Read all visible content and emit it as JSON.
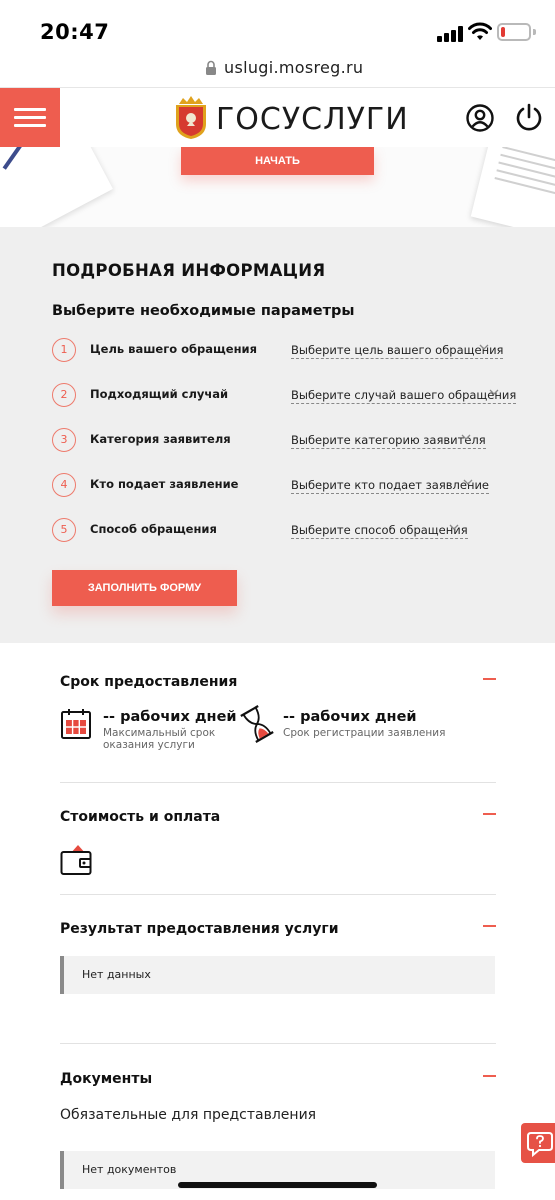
{
  "status_bar": {
    "time": "20:47"
  },
  "browser": {
    "url": "uslugi.mosreg.ru"
  },
  "header": {
    "logo_text": "ГОСУСЛУГИ"
  },
  "hero": {
    "start_button": "НАЧАТЬ"
  },
  "details": {
    "title": "ПОДРОБНАЯ ИНФОРМАЦИЯ",
    "subtitle": "Выберите необходимые параметры",
    "params": [
      {
        "num": "1",
        "label": "Цель вашего обращения",
        "placeholder": "Выберите цель вашего обращения"
      },
      {
        "num": "2",
        "label": "Подходящий случай",
        "placeholder": "Выберите случай вашего обращения"
      },
      {
        "num": "3",
        "label": "Категория заявителя",
        "placeholder": "Выберите категорию заявителя"
      },
      {
        "num": "4",
        "label": "Кто подает заявление",
        "placeholder": "Выберите кто подает заявление"
      },
      {
        "num": "5",
        "label": "Способ обращения",
        "placeholder": "Выберите способ обращения"
      }
    ],
    "fill_button": "ЗАПОЛНИТЬ ФОРМУ"
  },
  "term": {
    "title": "Срок предоставления",
    "max": {
      "value": "-- рабочих дней",
      "desc_line1": "Максимальный срок",
      "desc_line2": "оказания услуги"
    },
    "reg": {
      "value": "-- рабочих дней",
      "desc": "Срок регистрации заявления"
    }
  },
  "cost": {
    "title": "Стоимость и оплата"
  },
  "result": {
    "title": "Результат предоставления услуги",
    "text": "Нет данных"
  },
  "documents": {
    "title": "Документы",
    "subtitle": "Обязательные для представления",
    "text": "Нет документов"
  },
  "colors": {
    "accent": "#ee5d4f",
    "gray_bg": "#efefef"
  }
}
